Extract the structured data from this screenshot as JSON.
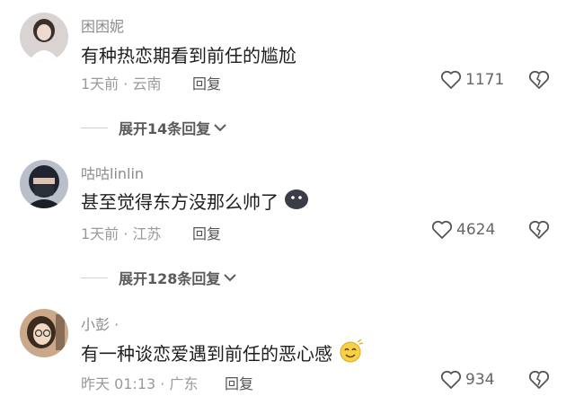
{
  "comments": [
    {
      "username": "困困妮",
      "text": "有种热恋期看到前任的尴尬",
      "time_location": "1天前 · 云南",
      "reply_label": "回复",
      "likes": "1171",
      "expand_label": "展开14条回复",
      "avatar_icon": "avatar-girl-white-dress",
      "emoji": ""
    },
    {
      "username": "咕咕linlin",
      "text": "甚至觉得东方没那么帅了",
      "time_location": "1天前 · 江苏",
      "reply_label": "回复",
      "likes": "4624",
      "expand_label": "展开128条回复",
      "avatar_icon": "avatar-masked-person",
      "emoji": "dark-blob-emoji"
    },
    {
      "username": "小彭 ·",
      "text": "有一种谈恋爱遇到前任的恶心感",
      "time_location": "昨天 01:13 · 广东",
      "reply_label": "回复",
      "likes": "934",
      "expand_label": "",
      "avatar_icon": "avatar-girl-glasses",
      "emoji": "squint-smile-emoji"
    }
  ],
  "colors": {
    "text": "#1e1e1e",
    "meta": "#9a9a9a",
    "icon": "#555555"
  }
}
